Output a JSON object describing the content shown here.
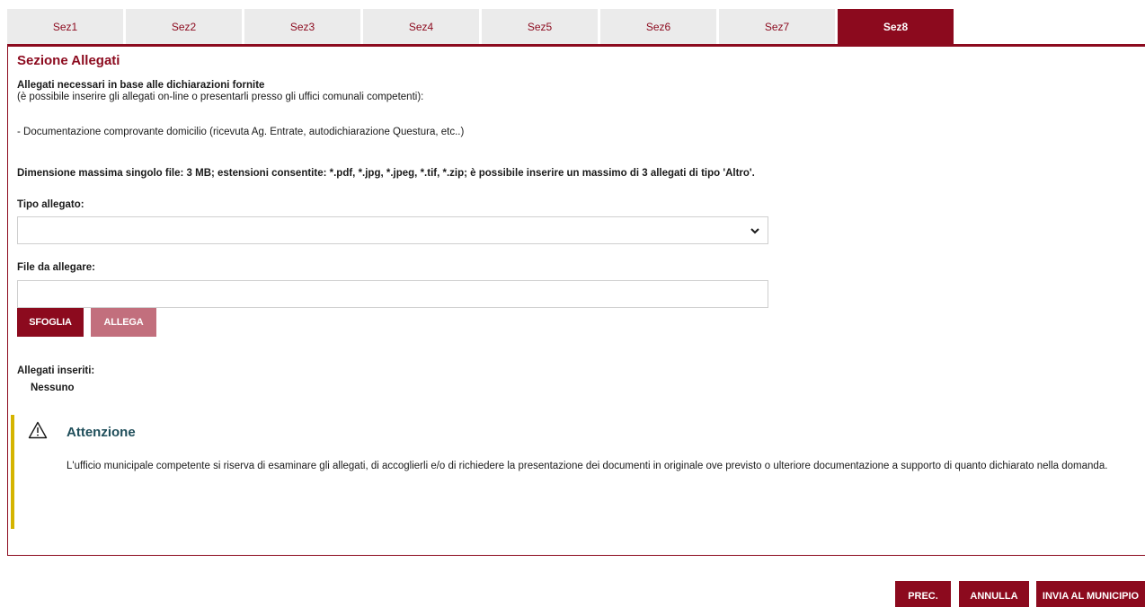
{
  "tabs": [
    {
      "label": "Sez1",
      "active": false
    },
    {
      "label": "Sez2",
      "active": false
    },
    {
      "label": "Sez3",
      "active": false
    },
    {
      "label": "Sez4",
      "active": false
    },
    {
      "label": "Sez5",
      "active": false
    },
    {
      "label": "Sez6",
      "active": false
    },
    {
      "label": "Sez7",
      "active": false
    },
    {
      "label": "Sez8",
      "active": true
    }
  ],
  "section": {
    "title": "Sezione Allegati",
    "required_heading": "Allegati necessari in base alle dichiarazioni fornite",
    "required_note": "(è possibile inserire gli allegati on-line o presentarli presso gli uffici comunali competenti):",
    "required_item": "- Documentazione comprovante domicilio (ricevuta Ag. Entrate, autodichiarazione Questura, etc..)",
    "limits": "Dimensione massima singolo file: 3 MB; estensioni consentite: *.pdf, *.jpg, *.jpeg, *.tif, *.zip; è possibile inserire un massimo di 3 allegati di tipo 'Altro'."
  },
  "form": {
    "type_label": "Tipo allegato:",
    "type_value": "",
    "file_label": "File da allegare:",
    "file_value": "",
    "browse_label": "SFOGLIA",
    "attach_label": "ALLEGA"
  },
  "attached": {
    "label": "Allegati inseriti:",
    "value": "Nessuno"
  },
  "notice": {
    "title": "Attenzione",
    "body": "L'ufficio municipale competente si riserva di esaminare gli allegati, di accoglierli e/o di richiedere la presentazione dei documenti in originale ove previsto o ulteriore documentazione a supporto di quanto dichiarato nella domanda."
  },
  "footer": {
    "prev_label": "PREC.",
    "cancel_label": "ANNULLA",
    "submit_label": "INVIA AL MUNICIPIO"
  },
  "colors": {
    "brand": "#8c0a1e",
    "brand_disabled": "#c26f7d",
    "notice_bar": "#d5b400",
    "notice_title": "#1f4e5a"
  },
  "icons": {
    "warning": "warning-icon",
    "dropdown": "chevron-down-icon"
  }
}
